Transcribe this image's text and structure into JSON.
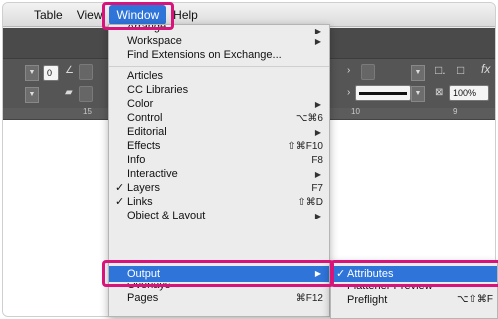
{
  "menubar": {
    "items": [
      "Table",
      "View",
      "Window",
      "Help"
    ]
  },
  "toolbar": {
    "field_value": "0",
    "zoom_value": "100%",
    "fx_label": "fx",
    "ruler_numbers": [
      "15",
      "10",
      "9"
    ]
  },
  "window_menu": {
    "items": [
      {
        "label": "Arrange",
        "shortcut": "",
        "submenu": true,
        "check": false
      },
      {
        "label": "Workspace",
        "shortcut": "",
        "submenu": true,
        "check": false
      },
      {
        "label": "Find Extensions on Exchange...",
        "shortcut": "",
        "submenu": false,
        "check": false
      },
      {
        "label": "Articles",
        "shortcut": "",
        "submenu": false,
        "check": false
      },
      {
        "label": "CC Libraries",
        "shortcut": "",
        "submenu": false,
        "check": false
      },
      {
        "label": "Color",
        "shortcut": "",
        "submenu": true,
        "check": false
      },
      {
        "label": "Control",
        "shortcut": "⌥⌘6",
        "submenu": false,
        "check": false
      },
      {
        "label": "Editorial",
        "shortcut": "",
        "submenu": true,
        "check": false
      },
      {
        "label": "Effects",
        "shortcut": "⇧⌘F10",
        "submenu": false,
        "check": false
      },
      {
        "label": "Info",
        "shortcut": "F8",
        "submenu": false,
        "check": false
      },
      {
        "label": "Interactive",
        "shortcut": "",
        "submenu": true,
        "check": false
      },
      {
        "label": "Layers",
        "shortcut": "F7",
        "submenu": false,
        "check": true
      },
      {
        "label": "Links",
        "shortcut": "⇧⌘D",
        "submenu": false,
        "check": true
      },
      {
        "label": "Object & Layout",
        "shortcut": "",
        "submenu": true,
        "check": false
      },
      {
        "label": "Output",
        "shortcut": "",
        "submenu": true,
        "check": false,
        "highlighted": true
      },
      {
        "label": "Overlays",
        "shortcut": "",
        "submenu": false,
        "check": false
      },
      {
        "label": "Pages",
        "shortcut": "⌘F12",
        "submenu": false,
        "check": false
      }
    ]
  },
  "output_submenu": {
    "items": [
      {
        "label": "Attributes",
        "shortcut": "",
        "check": true,
        "highlighted": true
      },
      {
        "label": "Flattener Preview",
        "shortcut": "",
        "check": false
      },
      {
        "label": "Preflight",
        "shortcut": "⌥⇧⌘F",
        "check": false
      }
    ]
  },
  "colors": {
    "accent": "#2f74d9",
    "callout": "#d8147a"
  }
}
